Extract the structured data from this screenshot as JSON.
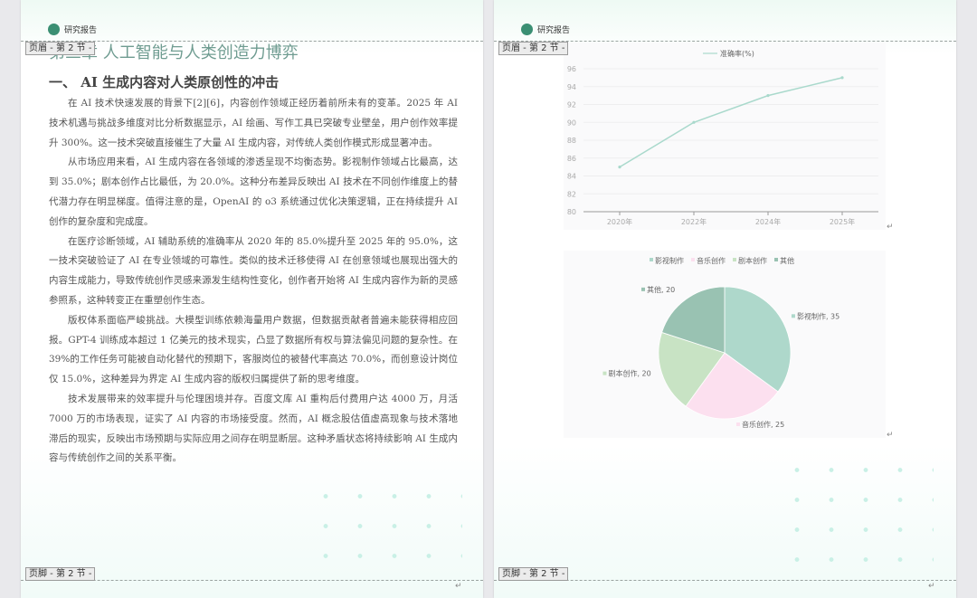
{
  "header": {
    "title": "研究报告",
    "header_tag": "页眉 - 第 2 节 -",
    "footer_tag": "页脚 - 第 2 节 -"
  },
  "left_page": {
    "chapter_title": "第三章   人工智能与人类创造力博弈",
    "section_title": "一、   AI 生成内容对人类原创性的冲击",
    "paragraphs": [
      "在 AI 技术快速发展的背景下[2][6]，内容创作领域正经历着前所未有的变革。2025 年 AI 技术机遇与挑战多维度对比分析数据显示，AI 绘画、写作工具已突破专业壁垒，用户创作效率提升 300%。这一技术突破直接催生了大量 AI 生成内容，对传统人类创作模式形成显著冲击。",
      "从市场应用来看，AI 生成内容在各领域的渗透呈现不均衡态势。影视制作领域占比最高，达到 35.0%；剧本创作占比最低，为 20.0%。这种分布差异反映出 AI 技术在不同创作维度上的替代潜力存在明显梯度。值得注意的是，OpenAI 的 o3 系统通过优化决策逻辑，正在持续提升 AI 创作的复杂度和完成度。",
      "在医疗诊断领域，AI 辅助系统的准确率从 2020 年的 85.0%提升至 2025 年的 95.0%，这一技术突破验证了 AI 在专业领域的可靠性。类似的技术迁移使得 AI 在创意领域也展现出强大的内容生成能力，导致传统创作灵感来源发生结构性变化，创作者开始将 AI 生成内容作为新的灵感参照系，这种转变正在重塑创作生态。",
      "版权体系面临严峻挑战。大模型训练依赖海量用户数据，但数据贡献者普遍未能获得相应回报。GPT-4 训练成本超过 1 亿美元的技术现实，凸显了数据所有权与算法偏见问题的复杂性。在 39%的工作任务可能被自动化替代的预期下，客服岗位的被替代率高达 70.0%，而创意设计岗位仅 15.0%，这种差异为界定 AI 生成内容的版权归属提供了新的思考维度。",
      "技术发展带来的效率提升与伦理困境并存。百度文库 AI 重构后付费用户达 4000 万，月活 7000 万的市场表现，证实了 AI 内容的市场接受度。然而，AI 概念股估值虚高现象与技术落地滞后的现实，反映出市场预期与实际应用之间存在明显断层。这种矛盾状态将持续影响 AI 生成内容与传统创作之间的关系平衡。"
    ]
  },
  "chart_data": [
    {
      "type": "line",
      "legend": [
        "准确率(%)"
      ],
      "categories": [
        "2020年",
        "2022年",
        "2024年",
        "2025年"
      ],
      "series": [
        {
          "name": "准确率(%)",
          "values": [
            85,
            90,
            93,
            95
          ]
        }
      ],
      "ylim": [
        80,
        96
      ],
      "yticks": [
        80,
        82,
        84,
        86,
        88,
        90,
        92,
        94,
        96
      ],
      "color": "#a9d9cc"
    },
    {
      "type": "pie",
      "legend": [
        "影视制作",
        "音乐创作",
        "剧本创作",
        "其他"
      ],
      "slices": [
        {
          "label": "影视制作",
          "value": 35,
          "text": "影视制作, 35",
          "color": "#aed8cb"
        },
        {
          "label": "音乐创作",
          "value": 25,
          "text": "音乐创作, 25",
          "color": "#fce0ef"
        },
        {
          "label": "剧本创作",
          "value": 20,
          "text": "剧本创作, 20",
          "color": "#c8e3c4"
        },
        {
          "label": "其他",
          "value": 20,
          "text": "其他, 20",
          "color": "#99c2b2"
        }
      ]
    }
  ]
}
